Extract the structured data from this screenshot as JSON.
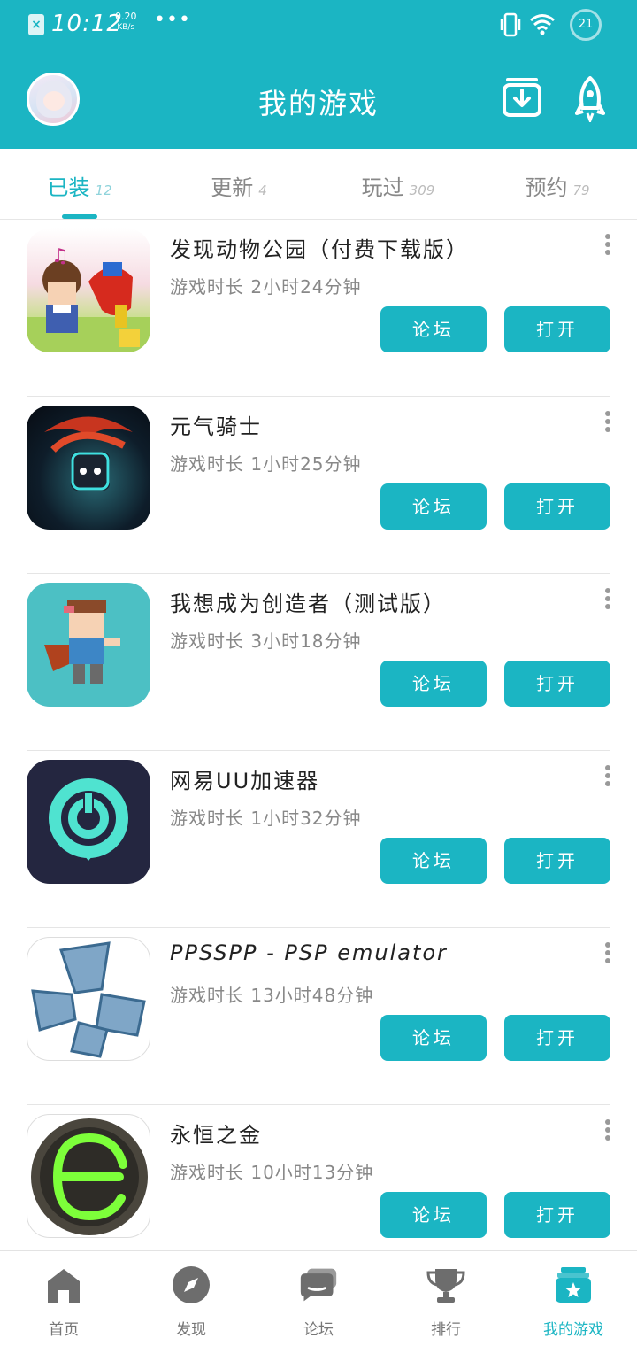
{
  "status": {
    "time": "10:12",
    "speed_value": "0.20",
    "speed_unit": "KB/s",
    "dots": "•••",
    "battery": "21"
  },
  "header": {
    "title": "我的游戏"
  },
  "tabs": [
    {
      "label": "已装",
      "count": "12"
    },
    {
      "label": "更新",
      "count": "4"
    },
    {
      "label": "玩过",
      "count": "309"
    },
    {
      "label": "预约",
      "count": "79"
    }
  ],
  "games": [
    {
      "name": "发现动物公园（付费下载版）",
      "playtime": "游戏时长 2小时24分钟"
    },
    {
      "name": "元气骑士",
      "playtime": "游戏时长 1小时25分钟"
    },
    {
      "name": "我想成为创造者（测试版）",
      "playtime": "游戏时长 3小时18分钟"
    },
    {
      "name": "网易UU加速器",
      "playtime": "游戏时长 1小时32分钟"
    },
    {
      "name": "PPSSPP - PSP emulator",
      "playtime": "游戏时长 13小时48分钟"
    },
    {
      "name": "永恒之金",
      "playtime": "游戏时长 10小时13分钟"
    }
  ],
  "buttons": {
    "forum": "论坛",
    "open": "打开"
  },
  "nav": [
    {
      "label": "首页",
      "icon": "home-icon"
    },
    {
      "label": "发现",
      "icon": "compass-icon"
    },
    {
      "label": "论坛",
      "icon": "chat-icon"
    },
    {
      "label": "排行",
      "icon": "trophy-icon"
    },
    {
      "label": "我的游戏",
      "icon": "game-card-icon"
    }
  ],
  "colors": {
    "accent": "#1bb5c3"
  }
}
